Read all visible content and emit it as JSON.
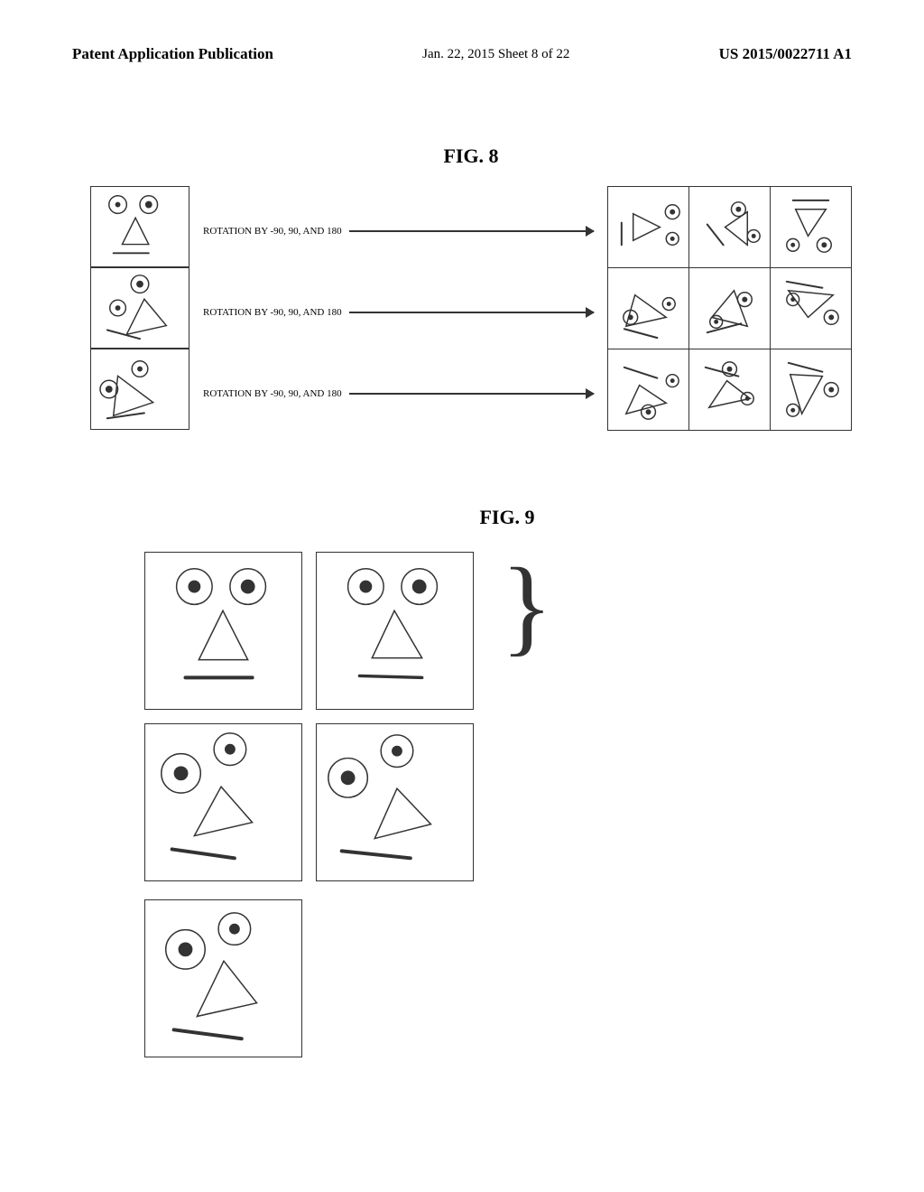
{
  "header": {
    "left": "Patent Application Publication",
    "center": "Jan. 22, 2015  Sheet 8 of 22",
    "right": "US 2015/0022711 A1"
  },
  "fig8": {
    "title": "FIG. 8",
    "arrow_label": "ROTATION BY -90, 90, AND 180"
  },
  "fig9": {
    "title": "FIG. 9"
  }
}
